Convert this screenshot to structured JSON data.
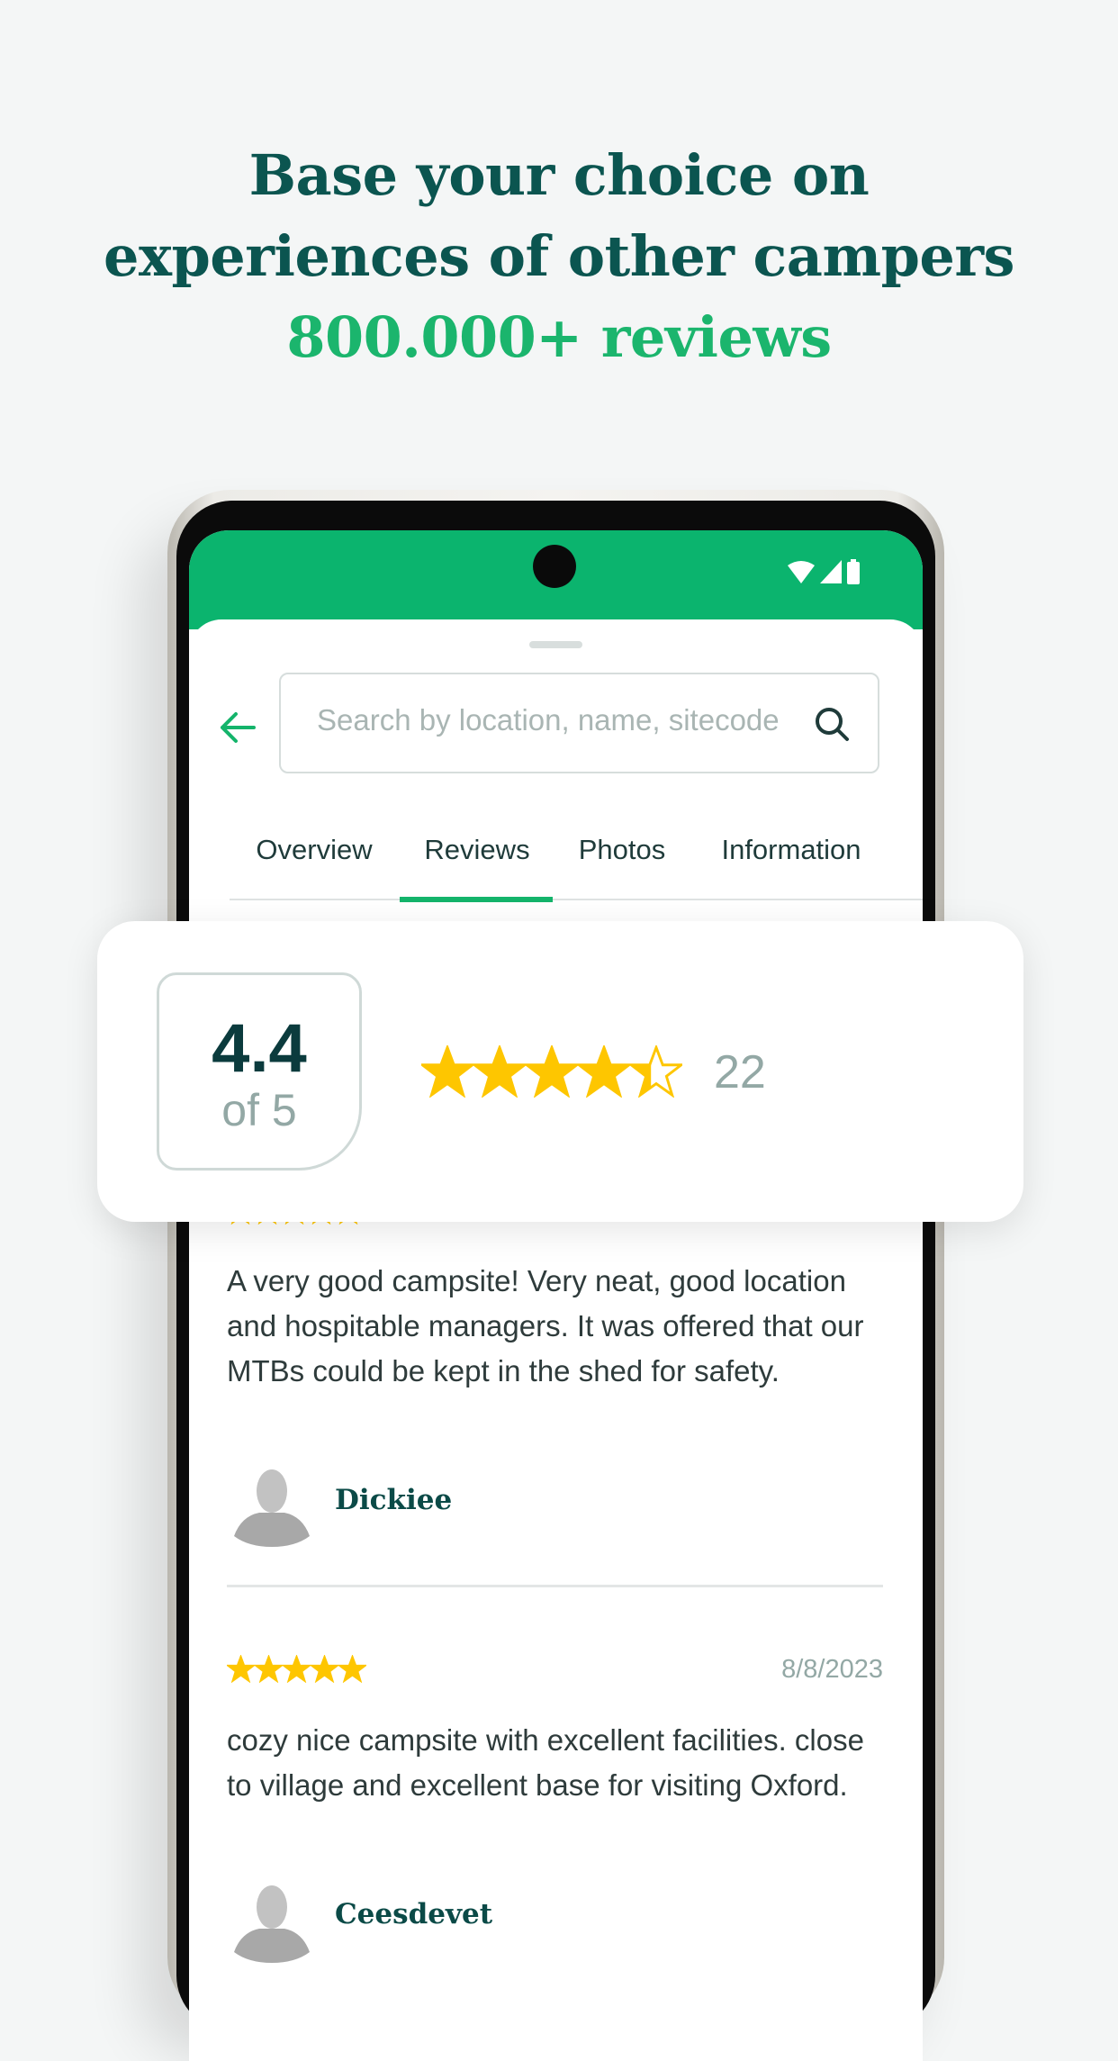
{
  "headline": {
    "line1": "Base your choice on",
    "line2": "experiences of other campers",
    "line3": "800.000+ reviews"
  },
  "colors": {
    "brand_green": "#0bb46e",
    "title_teal": "#0b5550",
    "star": "#fec600"
  },
  "status_icons": [
    "wifi-icon",
    "signal-icon",
    "battery-icon"
  ],
  "search": {
    "placeholder": "Search by location, name, sitecode"
  },
  "tabs": [
    {
      "label": "Overview",
      "active": false
    },
    {
      "label": "Reviews",
      "active": true
    },
    {
      "label": "Photos",
      "active": false
    },
    {
      "label": "Information",
      "active": false
    }
  ],
  "summary": {
    "score": "4.4",
    "of_label": "of 5",
    "rating": 4.4,
    "count": "22"
  },
  "reviews": [
    {
      "rating": 5,
      "text": "A very good campsite! Very neat, good location and hospitable managers. It was offered that our MTBs could be kept in the shed for safety.",
      "author": "Dickiee"
    },
    {
      "rating": 5,
      "date": "8/8/2023",
      "text": "cozy nice campsite with excellent facilities. close to village and excellent base for visiting Oxford.",
      "author": "Ceesdevet"
    }
  ]
}
